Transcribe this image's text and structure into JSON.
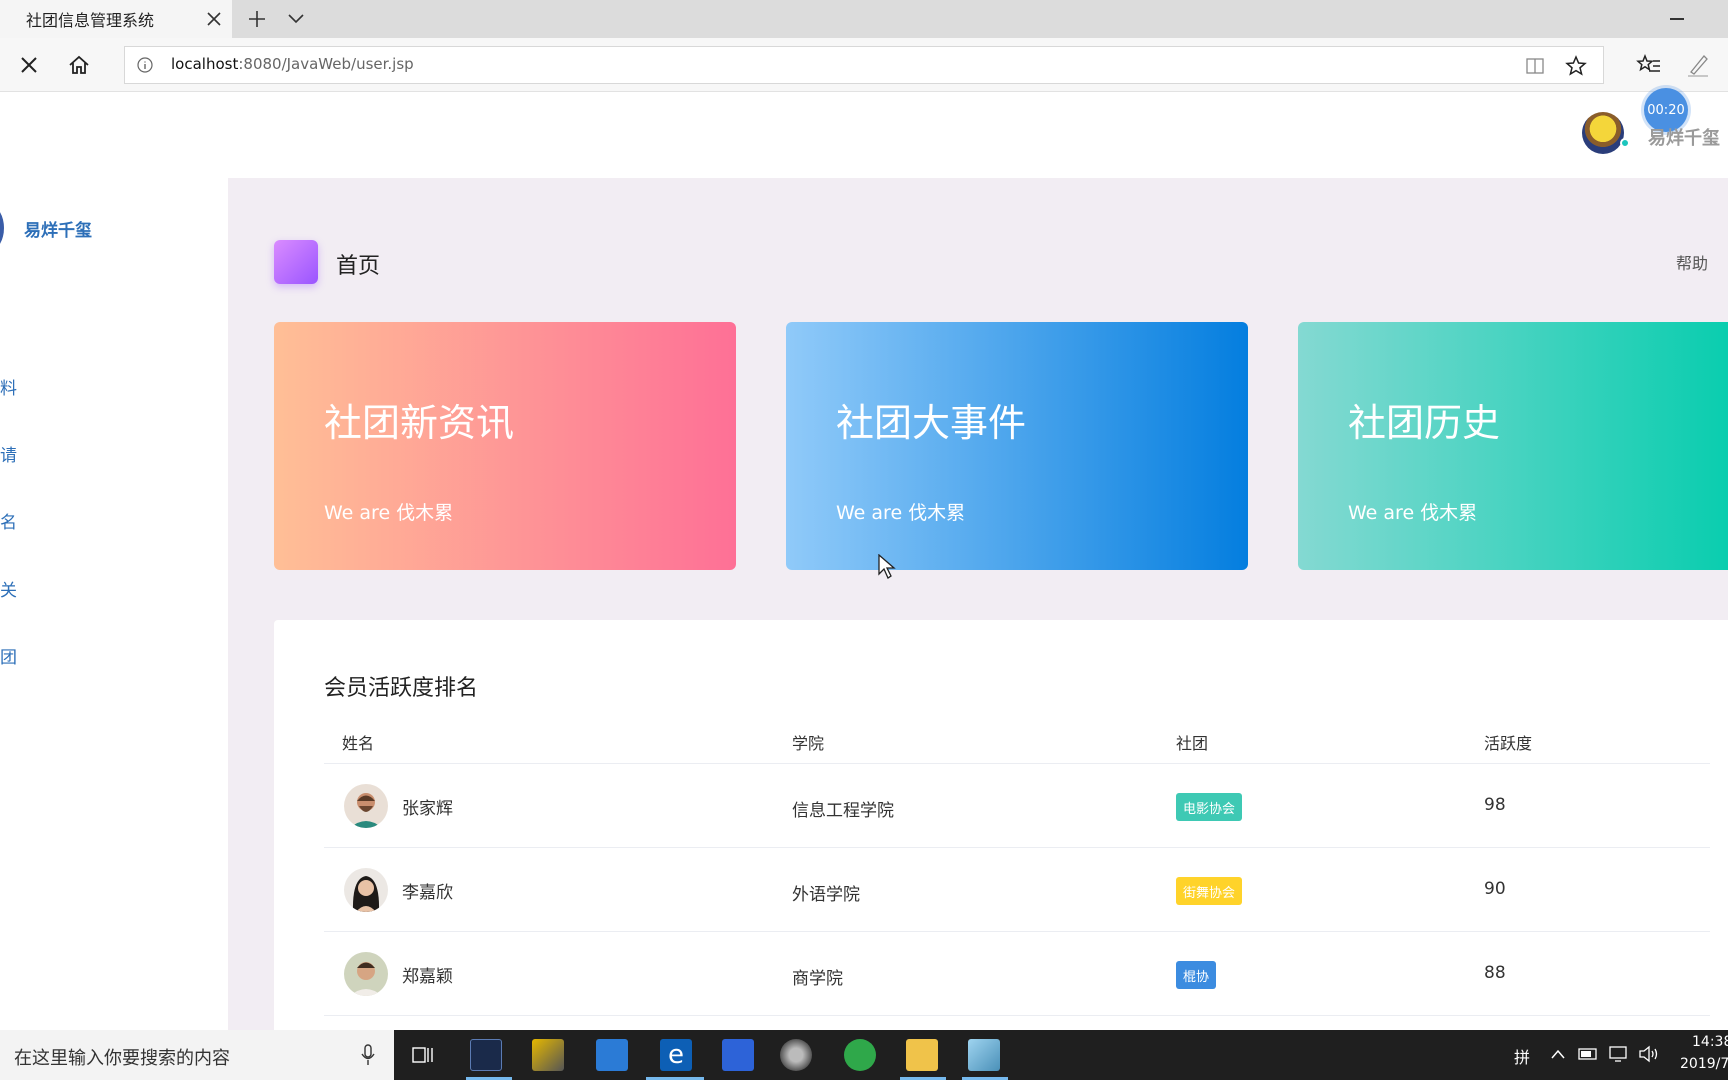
{
  "browser": {
    "tab_title": "社团信息管理系统",
    "url_host": "localhost",
    "url_path": ":8080/JavaWeb/user.jsp"
  },
  "header": {
    "username": "易烊千玺",
    "timer": "00:20"
  },
  "sidebar": {
    "username": "易烊千玺",
    "items": [
      {
        "label": "料"
      },
      {
        "label": "请"
      },
      {
        "label": "名"
      },
      {
        "label": "关"
      },
      {
        "label": "团"
      }
    ]
  },
  "main": {
    "page_title": "首页",
    "help": "帮助",
    "cards": [
      {
        "title": "社团新资讯",
        "subtitle": "We are 伐木累"
      },
      {
        "title": "社团大事件",
        "subtitle": "We are 伐木累"
      },
      {
        "title": "社团历史",
        "subtitle": "We are 伐木累"
      }
    ],
    "table": {
      "title": "会员活跃度排名",
      "headers": [
        "姓名",
        "学院",
        "社团",
        "活跃度"
      ],
      "rows": [
        {
          "name": "张家辉",
          "college": "信息工程学院",
          "club": "电影协会",
          "club_color": "#3ec9b4",
          "score": "98"
        },
        {
          "name": "李嘉欣",
          "college": "外语学院",
          "club": "街舞协会",
          "club_color": "#ffd32a",
          "score": "90"
        },
        {
          "name": "郑嘉颖",
          "college": "商学院",
          "club": "棍协",
          "club_color": "#3c8ce0",
          "score": "88"
        }
      ]
    }
  },
  "taskbar": {
    "search_placeholder": "在这里输入你要搜索的内容",
    "ime": "拼",
    "time": "14:38",
    "date": "2019/7"
  }
}
